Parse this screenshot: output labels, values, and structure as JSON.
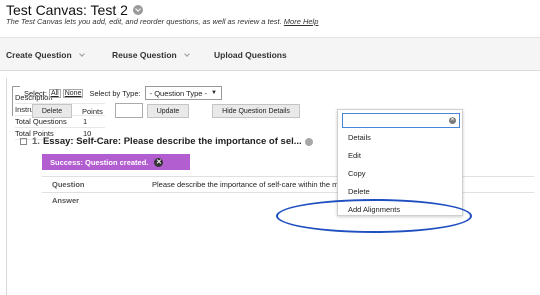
{
  "page": {
    "title": "Test Canvas: Test 2",
    "subtitle_text": "The Test Canvas lets you add, edit, and reorder questions, as well as review a test.",
    "more_help": "More Help"
  },
  "actionbar": {
    "create": "Create Question",
    "reuse": "Reuse Question",
    "upload": "Upload Questions"
  },
  "info": {
    "rows": [
      {
        "label": "Description",
        "value": ""
      },
      {
        "label": "Instructions",
        "value": ""
      },
      {
        "label": "Total Questions",
        "value": "1"
      },
      {
        "label": "Total Points",
        "value": "10"
      }
    ]
  },
  "toolbar": {
    "select_label": "Select:",
    "all": "All",
    "none": "None",
    "type_label": "Select by Type:",
    "type_value": "- Question Type -",
    "delete": "Delete",
    "points_label": "Points",
    "update": "Update",
    "hide_details": "Hide Question Details"
  },
  "question": {
    "number": "1.",
    "title": "Essay: Self-Care: Please describe the importance of sel...",
    "success": "Success: Question created.",
    "rows": [
      {
        "label": "Question",
        "value": "Please describe the importance of self-care within the massage therapy field."
      },
      {
        "label": "Answer",
        "value": ""
      }
    ]
  },
  "menu": {
    "search_value": "",
    "items": [
      "Details",
      "Edit",
      "Copy",
      "Delete",
      "Add Alignments"
    ]
  },
  "colors": {
    "success_bg": "#b35ed0",
    "annotation_ellipse": "#1f4fc0",
    "focus_blue": "#4a86d8"
  }
}
